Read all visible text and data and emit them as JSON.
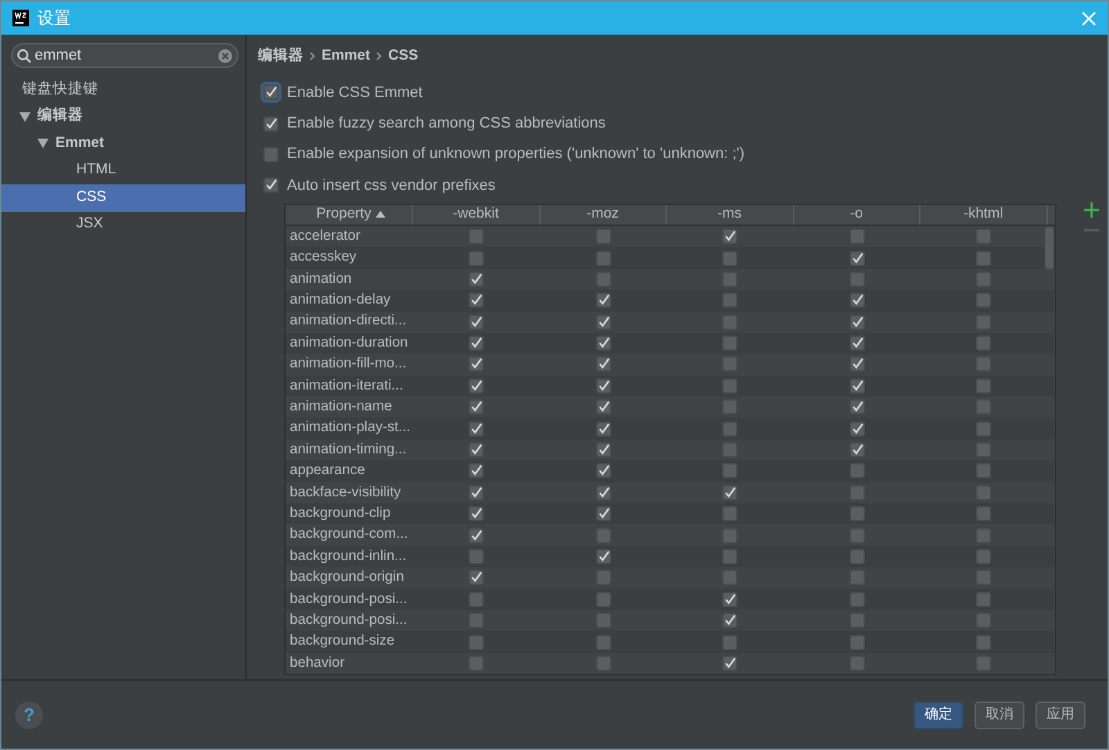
{
  "window": {
    "title": "设置"
  },
  "search": {
    "value": "emmet"
  },
  "sidebar": {
    "items": [
      {
        "label": "键盘快捷键",
        "selected": false
      },
      {
        "label": "编辑器",
        "selected": false,
        "expanded": true,
        "children": [
          {
            "label": "Emmet",
            "selected": false,
            "expanded": true,
            "children": [
              {
                "label": "HTML",
                "selected": false
              },
              {
                "label": "CSS",
                "selected": true
              },
              {
                "label": "JSX",
                "selected": false
              }
            ]
          }
        ]
      }
    ]
  },
  "breadcrumb": [
    "编辑器",
    "Emmet",
    "CSS"
  ],
  "options": [
    {
      "label": "Enable CSS Emmet",
      "checked": true,
      "focused": true
    },
    {
      "label": "Enable fuzzy search among CSS abbreviations",
      "checked": true,
      "focused": false
    },
    {
      "label": "Enable expansion of unknown properties ('unknown' to 'unknown: ;')",
      "checked": false,
      "focused": false
    },
    {
      "label": "Auto insert css vendor prefixes",
      "checked": true,
      "focused": false
    }
  ],
  "table": {
    "columns": [
      {
        "label": "Property",
        "sorted": true
      },
      {
        "label": "-webkit",
        "sorted": false
      },
      {
        "label": "-moz",
        "sorted": false
      },
      {
        "label": "-ms",
        "sorted": false
      },
      {
        "label": "-o",
        "sorted": false
      },
      {
        "label": "-khtml",
        "sorted": false
      }
    ],
    "rows": [
      {
        "property": "accelerator",
        "checks": [
          false,
          false,
          true,
          false,
          false
        ]
      },
      {
        "property": "accesskey",
        "checks": [
          false,
          false,
          false,
          true,
          false
        ]
      },
      {
        "property": "animation",
        "checks": [
          true,
          false,
          false,
          false,
          false
        ]
      },
      {
        "property": "animation-delay",
        "checks": [
          true,
          true,
          false,
          true,
          false
        ]
      },
      {
        "property": "animation-directi...",
        "checks": [
          true,
          true,
          false,
          true,
          false
        ]
      },
      {
        "property": "animation-duration",
        "checks": [
          true,
          true,
          false,
          true,
          false
        ]
      },
      {
        "property": "animation-fill-mo...",
        "checks": [
          true,
          true,
          false,
          true,
          false
        ]
      },
      {
        "property": "animation-iterati...",
        "checks": [
          true,
          true,
          false,
          true,
          false
        ]
      },
      {
        "property": "animation-name",
        "checks": [
          true,
          true,
          false,
          true,
          false
        ]
      },
      {
        "property": "animation-play-st...",
        "checks": [
          true,
          true,
          false,
          true,
          false
        ]
      },
      {
        "property": "animation-timing...",
        "checks": [
          true,
          true,
          false,
          true,
          false
        ]
      },
      {
        "property": "appearance",
        "checks": [
          true,
          true,
          false,
          false,
          false
        ]
      },
      {
        "property": "backface-visibility",
        "checks": [
          true,
          true,
          true,
          false,
          false
        ]
      },
      {
        "property": "background-clip",
        "checks": [
          true,
          true,
          false,
          false,
          false
        ]
      },
      {
        "property": "background-com...",
        "checks": [
          true,
          false,
          false,
          false,
          false
        ]
      },
      {
        "property": "background-inlin...",
        "checks": [
          false,
          true,
          false,
          false,
          false
        ]
      },
      {
        "property": "background-origin",
        "checks": [
          true,
          false,
          false,
          false,
          false
        ]
      },
      {
        "property": "background-posi...",
        "checks": [
          false,
          false,
          true,
          false,
          false
        ]
      },
      {
        "property": "background-posi...",
        "checks": [
          false,
          false,
          true,
          false,
          false
        ]
      },
      {
        "property": "background-size",
        "checks": [
          false,
          false,
          false,
          false,
          false
        ]
      },
      {
        "property": "behavior",
        "checks": [
          false,
          false,
          true,
          false,
          false
        ]
      }
    ]
  },
  "help": "?",
  "buttons": [
    {
      "label": "确定",
      "default": true
    },
    {
      "label": "取消",
      "default": false
    },
    {
      "label": "应用",
      "default": false
    }
  ]
}
